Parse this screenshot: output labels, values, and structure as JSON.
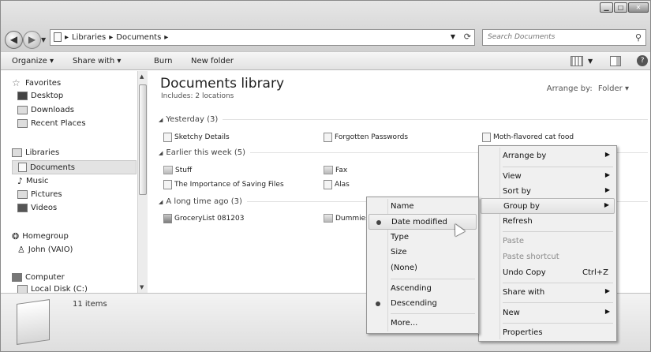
{
  "titlebar": {
    "caption_buttons": [
      "minimize-icon",
      "maximize-icon",
      "close-icon"
    ],
    "address_crumbs": [
      "Libraries",
      "Documents"
    ],
    "search_placeholder": "Search Documents"
  },
  "toolbar": {
    "organize": "Organize ▾",
    "share_with": "Share with ▾",
    "burn": "Burn",
    "new_folder": "New folder"
  },
  "nav": {
    "favorites": "Favorites",
    "desktop": "Desktop",
    "downloads": "Downloads",
    "recent_places": "Recent Places",
    "libraries": "Libraries",
    "documents": "Documents",
    "music": "Music",
    "pictures": "Pictures",
    "videos": "Videos",
    "homegroup": "Homegroup",
    "john": "John (VAIO)",
    "computer": "Computer",
    "local_disk": "Local Disk (C:)"
  },
  "content": {
    "title": "Documents library",
    "includes": "Includes:",
    "includes_link": "2 locations",
    "arrange_label": "Arrange by:",
    "arrange_value": "Folder ▾",
    "groups": [
      {
        "label": "Yesterday (3)",
        "files": [
          "Sketchy Details",
          "Forgotten Passwords",
          "Moth-flavored cat food"
        ]
      },
      {
        "label": "Earlier this week (5)",
        "files": [
          "Stuff",
          "Fax",
          "The Importance of Saving Files",
          "Alas"
        ]
      },
      {
        "label": "A long time ago (3)",
        "files": [
          "GroceryList 081203",
          "Dummies"
        ]
      }
    ]
  },
  "details": {
    "count": "11 items"
  },
  "context_menu": {
    "arrange_by": "Arrange by",
    "view": "View",
    "sort_by": "Sort by",
    "group_by": "Group by",
    "refresh": "Refresh",
    "paste": "Paste",
    "paste_shortcut": "Paste shortcut",
    "undo_copy": "Undo Copy",
    "undo_shortcut": "Ctrl+Z",
    "share_with": "Share with",
    "new": "New",
    "properties": "Properties"
  },
  "group_submenu": {
    "name": "Name",
    "date_modified": "Date modified",
    "type": "Type",
    "size": "Size",
    "none": "(None)",
    "ascending": "Ascending",
    "descending": "Descending",
    "more": "More..."
  }
}
